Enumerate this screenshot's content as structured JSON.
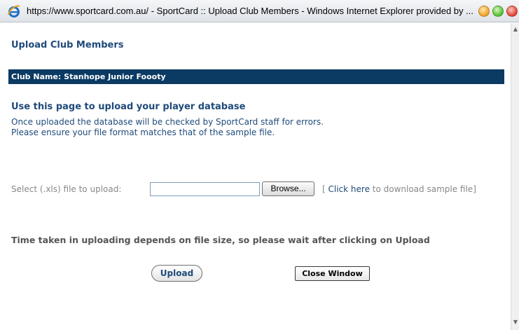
{
  "window": {
    "title": "https://www.sportcard.com.au/ - SportCard :: Upload Club Members - Windows Internet Explorer provided by ...",
    "icon": "ie-icon"
  },
  "page": {
    "title": "Upload Club Members",
    "club_name": "Club Name: Stanhope Junior Foooty",
    "section_heading": "Use this page to upload your player database",
    "info_line1": "Once uploaded the database will be checked by SportCard staff for errors.",
    "info_line2": "Please ensure your file format matches that of the sample file."
  },
  "upload_form": {
    "select_label": "Select (.xls) file to upload:",
    "file_value": "",
    "browse_label": "Browse...",
    "sample_prefix": "[ ",
    "sample_link": "Click here",
    "sample_suffix": " to download sample file]"
  },
  "notice": "Time taken in uploading depends on file size, so please wait after clicking on Upload",
  "buttons": {
    "upload_label": "Upload",
    "close_label": "Close Window"
  },
  "scrollbar": {
    "up_arrow": "▲",
    "down_arrow": "▼"
  }
}
